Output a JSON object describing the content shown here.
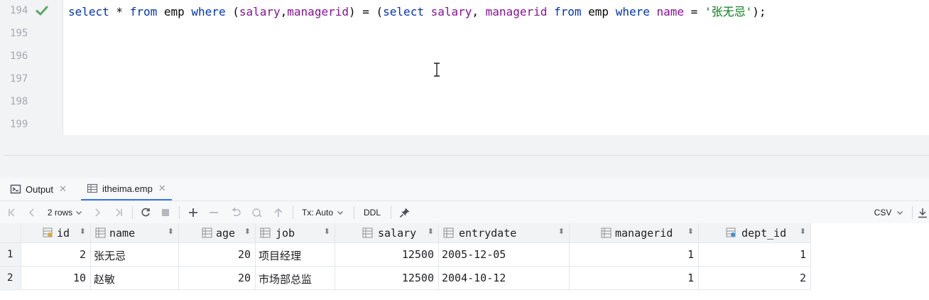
{
  "editor": {
    "lines": [
      {
        "num": "194",
        "status": "check-icon"
      },
      {
        "num": "195"
      },
      {
        "num": "196"
      },
      {
        "num": "197"
      },
      {
        "num": "198"
      },
      {
        "num": "199"
      }
    ],
    "code": {
      "t1": "select",
      "t2": " * ",
      "t3": "from",
      "t4": " emp ",
      "t5": "where",
      "t6": " (",
      "t7": "salary",
      "t8": ",",
      "t9": "managerid",
      "t10": ") = (",
      "t11": "select",
      "t12": " ",
      "t13": "salary",
      "t14": ", ",
      "t15": "managerid",
      "t16": " ",
      "t17": "from",
      "t18": " emp ",
      "t19": "where",
      "t20": " ",
      "t21": "name",
      "t22": " = ",
      "t23": "'张无忌'",
      "t24": ");"
    }
  },
  "tabs": {
    "output": "Output",
    "result": "itheima.emp"
  },
  "toolbar": {
    "rows": "2 rows",
    "tx": "Tx: Auto",
    "ddl": "DDL",
    "export": "CSV"
  },
  "grid": {
    "columns": [
      "id",
      "name",
      "age",
      "job",
      "salary",
      "entrydate",
      "managerid",
      "dept_id"
    ],
    "rows": [
      {
        "n": "1",
        "id": "2",
        "name": "张无忌",
        "age": "20",
        "job": "项目经理",
        "salary": "12500",
        "entrydate": "2005-12-05",
        "managerid": "1",
        "dept_id": "1"
      },
      {
        "n": "2",
        "id": "10",
        "name": "赵敏",
        "age": "20",
        "job": "市场部总监",
        "salary": "12500",
        "entrydate": "2004-10-12",
        "managerid": "1",
        "dept_id": "2"
      }
    ]
  },
  "colors": {
    "keyword": "#0033b3",
    "field": "#871094",
    "string": "#067d17",
    "check": "#59a869",
    "accent": "#3574f0"
  }
}
